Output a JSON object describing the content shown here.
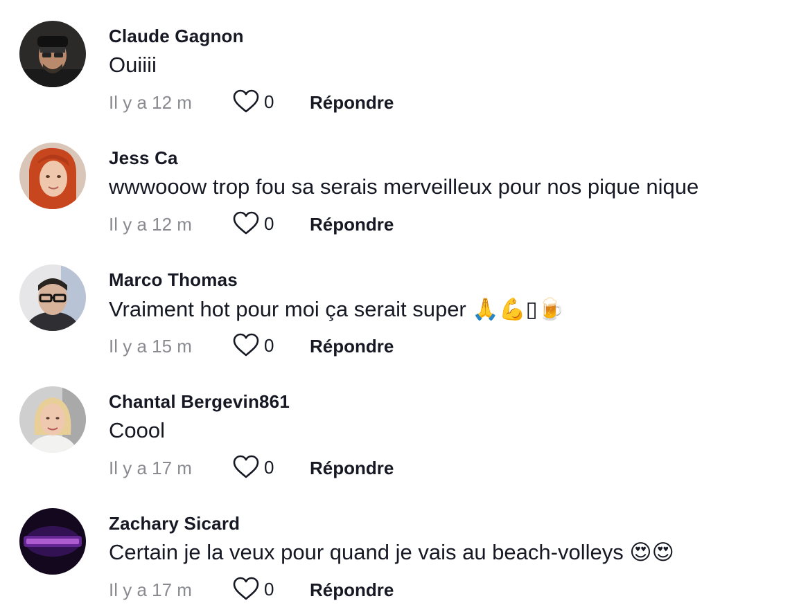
{
  "comments": [
    {
      "username": "Claude Gagnon",
      "text": "Ouiiii",
      "time": "Il y a 12 m",
      "likes": "0",
      "reply_label": "Répondre"
    },
    {
      "username": "Jess Ca",
      "text": "wwwooow trop fou sa serais merveilleux pour nos pique nique",
      "time": "Il y a 12 m",
      "likes": "0",
      "reply_label": "Répondre"
    },
    {
      "username": "Marco Thomas",
      "text": "Vraiment hot pour moi ça serait super 🙏💪▯🍺",
      "time": "Il y a 15 m",
      "likes": "0",
      "reply_label": "Répondre"
    },
    {
      "username": "Chantal Bergevin861",
      "text": "Coool",
      "time": "Il y a 17 m",
      "likes": "0",
      "reply_label": "Répondre"
    },
    {
      "username": "Zachary Sicard",
      "text": "Certain je la veux pour quand je vais au beach-volleys 😍😍",
      "time": "Il y a 17 m",
      "likes": "0",
      "reply_label": "Répondre"
    }
  ],
  "icons": {
    "like": "heart-outline-icon"
  },
  "colors": {
    "text": "#161823",
    "muted": "#8a8b91",
    "background": "#ffffff"
  }
}
